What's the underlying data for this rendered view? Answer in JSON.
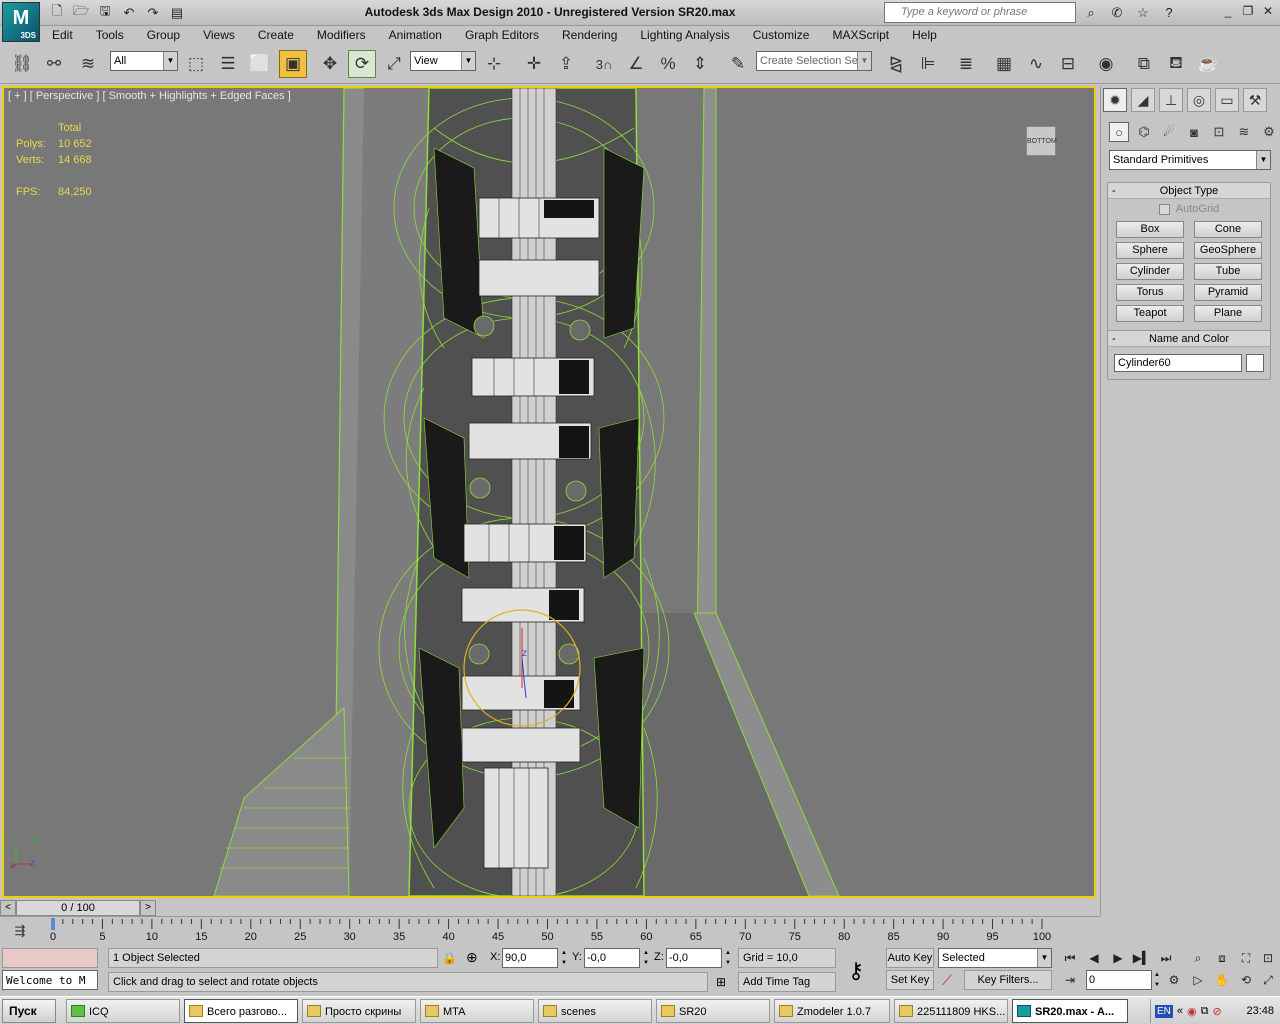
{
  "app": {
    "logo_text": "M",
    "logo_sub": "3DS",
    "title": "Autodesk 3ds Max Design 2010  - Unregistered Version    SR20.max",
    "search_placeholder": "Type a keyword or phrase"
  },
  "menu": [
    "Edit",
    "Tools",
    "Group",
    "Views",
    "Create",
    "Modifiers",
    "Animation",
    "Graph Editors",
    "Rendering",
    "Lighting Analysis",
    "Customize",
    "MAXScript",
    "Help"
  ],
  "toolbar": {
    "selection_filter": "All",
    "ref_coord": "View",
    "named_selection_placeholder": "Create Selection Se",
    "snap_label": "3"
  },
  "viewport": {
    "label": "[ + ] [ Perspective ] [ Smooth + Highlights + Edged Faces ]",
    "stats_header": "Total",
    "polys_label": "Polys:",
    "polys_value": "10 652",
    "verts_label": "Verts:",
    "verts_value": "14 668",
    "fps_label": "FPS:",
    "fps_value": "84,250",
    "viewcube_label": "BOTTOM",
    "axis_y": "y",
    "axis_x": "x",
    "axis_z": "z",
    "gizmo_axis": "z"
  },
  "command_panel": {
    "dropdown": "Standard Primitives",
    "object_type_title": "Object Type",
    "autogrid_label": "AutoGrid",
    "primitives": [
      "Box",
      "Cone",
      "Sphere",
      "GeoSphere",
      "Cylinder",
      "Tube",
      "Torus",
      "Pyramid",
      "Teapot",
      "Plane"
    ],
    "name_color_title": "Name and Color",
    "object_name": "Cylinder60"
  },
  "timeline": {
    "slider_text": "0 / 100",
    "ticks": [
      "0",
      "5",
      "10",
      "15",
      "20",
      "25",
      "30",
      "35",
      "40",
      "45",
      "50",
      "55",
      "60",
      "65",
      "70",
      "75",
      "80",
      "85",
      "90",
      "95",
      "100"
    ]
  },
  "status": {
    "welcome": "Welcome to M",
    "selection": "1 Object Selected",
    "prompt": "Click and drag to select and rotate objects",
    "x_label": "X:",
    "x_value": "90,0",
    "y_label": "Y:",
    "y_value": "-0,0",
    "z_label": "Z:",
    "z_value": "-0,0",
    "grid": "Grid = 10,0",
    "add_time_tag": "Add Time Tag",
    "auto_key": "Auto Key",
    "set_key": "Set Key",
    "key_mode": "Selected",
    "key_filters": "Key Filters...",
    "frame": "0"
  },
  "taskbar": {
    "start": "Пуск",
    "items": [
      "ICQ",
      "Всего разгово...",
      "Просто скрины",
      "MTA",
      "scenes",
      "SR20",
      "Zmodeler 1.0.7",
      "225111809 HKS...",
      "SR20.max - A..."
    ],
    "lang": "EN",
    "clock": "23:48"
  },
  "colors": {
    "viewport_bg": "#787878",
    "wire": "#8fdc3c",
    "active_border": "#f0d000",
    "stats": "#e8d84a"
  }
}
